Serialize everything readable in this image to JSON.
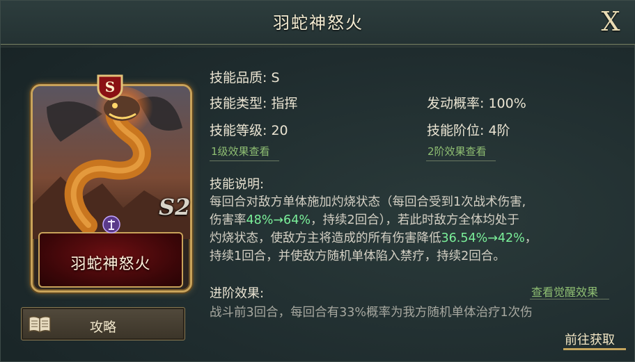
{
  "dialog": {
    "title": "羽蛇神怒火",
    "close_label": "X"
  },
  "card": {
    "name": "羽蛇神怒火",
    "grade_badge": "S",
    "level_badge": "S2"
  },
  "guide_button": {
    "label": "攻略",
    "icon": "book-icon"
  },
  "info": {
    "quality": "技能品质: S",
    "type": "技能类型: 指挥",
    "level": "技能等级: 20",
    "chance": "发动概率: 100%",
    "tier": "技能阶位: 4阶",
    "link_lv1": "1级效果查看",
    "link_tier2": "2阶效果查看"
  },
  "description": {
    "heading": "技能说明:",
    "line1": "每回合对敌方单体施加灼烧状态（每回合受到1次战术伤害,",
    "line2_a": "伤害率",
    "line2_hl": "48%→64%",
    "line2_b": "，持续2回合），若此时敌方全体均处于",
    "line3_a": "灼烧状态，使敌方主将造成的所有伤害降低",
    "line3_hl": "36.54%→42%",
    "line3_b": "，",
    "line4": "持续1回合，并使敌方随机单体陷入禁疗，持续2回合。"
  },
  "advanced": {
    "heading": "进阶效果:",
    "link": "查看觉醒效果",
    "text": "战斗前3回合，每回合有33%概率为我方随机单体治疗1次伤"
  },
  "goto_button": {
    "label": "前往获取"
  },
  "colors": {
    "highlight": "#7bf09a",
    "link": "#8fbf73",
    "gold": "#c9a35a",
    "name_bg": "#6b0f12"
  }
}
